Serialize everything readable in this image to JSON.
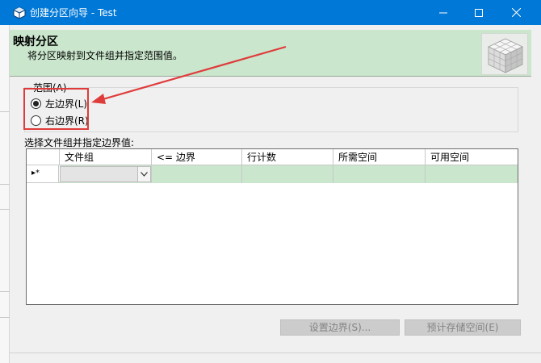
{
  "window": {
    "title": "创建分区向导 - Test",
    "accent_color": "#0078d7",
    "icons": {
      "app": "wizard-cube-icon",
      "minimize": "minimize-icon",
      "maximize": "maximize-icon",
      "close": "close-icon"
    }
  },
  "banner": {
    "title": "映射分区",
    "subtitle": "将分区映射到文件组并指定范围值。",
    "background_color": "#cae6cc",
    "logo": "partition-cube-logo"
  },
  "range": {
    "label": "范围(A)",
    "options": [
      {
        "label": "左边界(L)",
        "checked": true
      },
      {
        "label": "右边界(R)",
        "checked": false
      }
    ]
  },
  "grid": {
    "label": "选择文件组并指定边界值:",
    "columns": [
      "",
      "文件组",
      "<= 边界",
      "行计数",
      "所需空间",
      "可用空间"
    ],
    "new_row_marker": "▸*",
    "filegroup_value": ""
  },
  "buttons": {
    "set_bounds": "设置边界(S)...",
    "estimate_storage": "预计存储空间(E)"
  },
  "annotation": {
    "color": "#e03b3b"
  }
}
